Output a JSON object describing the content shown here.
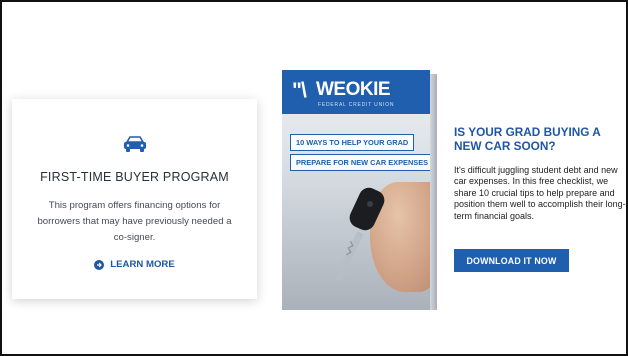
{
  "card": {
    "title": "FIRST-TIME BUYER PROGRAM",
    "description": "This program offers financing options for borrowers that may have previously needed a co-signer.",
    "link_label": "LEARN MORE",
    "icon": "car-icon"
  },
  "book": {
    "logo_mark": "\"\\",
    "logo_text": "WEOKIE",
    "logo_subtitle": "FEDERAL CREDIT UNION",
    "banner_line1": "10 WAYS TO HELP YOUR GRAD",
    "banner_line2": "PREPARE FOR NEW CAR EXPENSES"
  },
  "promo": {
    "title": "IS YOUR GRAD BUYING A NEW CAR SOON?",
    "description": "It's difficult juggling student debt and new car expenses. In this free checklist, we share 10 crucial tips to help prepare and position them well to accomplish their long-term financial goals.",
    "button_label": "DOWNLOAD IT NOW"
  },
  "colors": {
    "brand_blue": "#1f5fae",
    "text_dark": "#2a2f3a",
    "frame_border": "#111111"
  }
}
